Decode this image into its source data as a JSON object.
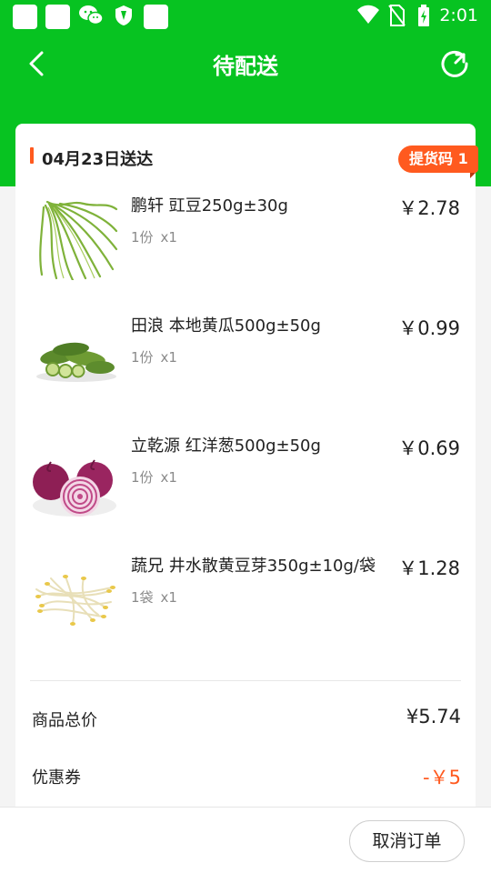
{
  "status_bar": {
    "time": "2:01",
    "left_icons": [
      "notification-square-icon",
      "notification-square-icon",
      "wechat-icon",
      "shield-icon",
      "notification-square-icon"
    ],
    "right_icons": [
      "wifi-icon",
      "no-sim-icon",
      "battery-charging-icon"
    ]
  },
  "header": {
    "title": "待配送",
    "back_icon": "chevron-left-icon",
    "refresh_icon": "refresh-icon",
    "background_color": "#07c321"
  },
  "order": {
    "delivery_date": "04月23日送达",
    "pickup_code": "提货码 1",
    "accent_color": "#ff5a1f",
    "items": [
      {
        "name": "鹏轩  豇豆250g±30g",
        "unit": "1份",
        "count": "x1",
        "price": "￥2.78",
        "thumb": "long-beans-image"
      },
      {
        "name": "田浪 本地黄瓜500g±50g",
        "unit": "1份",
        "count": "x1",
        "price": "￥0.99",
        "thumb": "cucumber-image"
      },
      {
        "name": "立乾源 红洋葱500g±50g",
        "unit": "1份",
        "count": "x1",
        "price": "￥0.69",
        "thumb": "red-onion-image"
      },
      {
        "name": "蔬兄 井水散黄豆芽350g±10g/袋",
        "unit": "1袋",
        "count": "x1",
        "price": "￥1.28",
        "thumb": "bean-sprouts-image"
      }
    ],
    "summary": {
      "subtotal_label": "商品总价",
      "subtotal_value": "¥5.74",
      "coupon_label": "优惠券",
      "coupon_value": "-￥5"
    }
  },
  "bottom_bar": {
    "cancel_label": "取消订单"
  }
}
